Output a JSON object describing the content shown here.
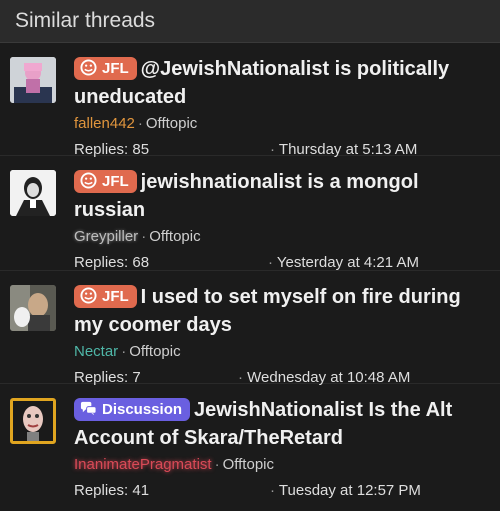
{
  "header": {
    "title": "Similar threads"
  },
  "colors": {
    "jfl_badge": "#e06a4e",
    "discussion_badge": "#6a5fe0",
    "accent_orange": "#e0953d",
    "accent_teal": "#4fb7a8",
    "accent_red": "#d94a57"
  },
  "threads": [
    {
      "badge": "JFL",
      "title": "@JewishNationalist is politically uneducated",
      "author": "fallen442",
      "forum": "Offtopic",
      "replies": "Replies: 85",
      "date": "Thursday at 5:13 AM"
    },
    {
      "badge": "JFL",
      "title": "jewishnationalist is a mongol russian",
      "author": "Greypiller",
      "forum": "Offtopic",
      "replies": "Replies: 68",
      "date": "Yesterday at 4:21 AM"
    },
    {
      "badge": "JFL",
      "title": "I used to set myself on fire during my coomer days",
      "author": "Nectar",
      "forum": "Offtopic",
      "replies": "Replies: 7",
      "date": "Wednesday at 10:48 AM"
    },
    {
      "badge": "Discussion",
      "title": "JewishNationalist Is the Alt Account of Skara/TheRetard",
      "author": "InanimatePragmatist",
      "forum": "Offtopic",
      "replies": "Replies: 41",
      "date": "Tuesday at 12:57 PM"
    }
  ]
}
